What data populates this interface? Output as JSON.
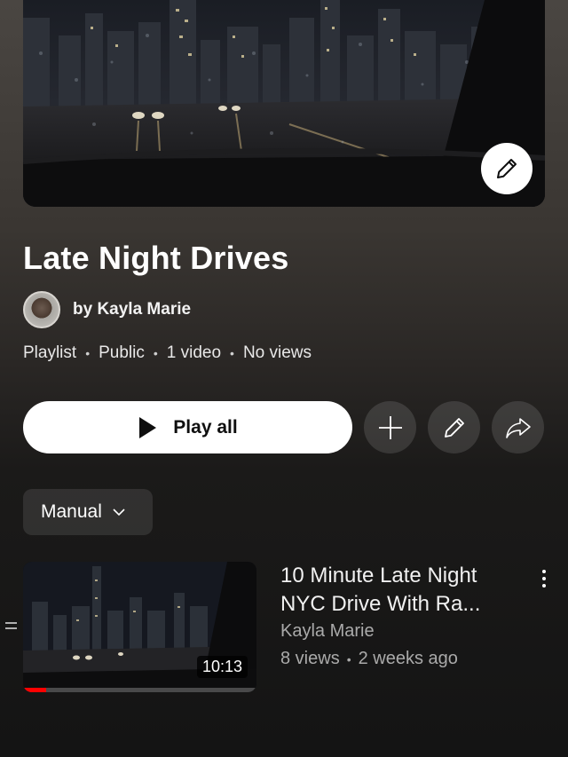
{
  "playlist": {
    "title": "Late Night Drives",
    "owner": "by Kayla Marie",
    "meta": {
      "type": "Playlist",
      "visibility": "Public",
      "video_count": "1 video",
      "views": "No views"
    },
    "separator": "•"
  },
  "actions": {
    "play_all_label": "Play all",
    "play_icon": "play-icon",
    "add_icon": "plus-icon",
    "edit_icon": "pencil-icon",
    "share_icon": "share-icon"
  },
  "sort": {
    "selected": "Manual"
  },
  "videos": [
    {
      "title": "10 Minute Late Night NYC Drive With Ra...",
      "channel": "Kayla Marie",
      "views": "8 views",
      "age": "2 weeks ago",
      "duration": "10:13",
      "progress": 0.1
    }
  ],
  "colors": {
    "accent": "#ff0000",
    "button_bg": "#ffffff",
    "text_secondary": "#aaaaaa"
  }
}
